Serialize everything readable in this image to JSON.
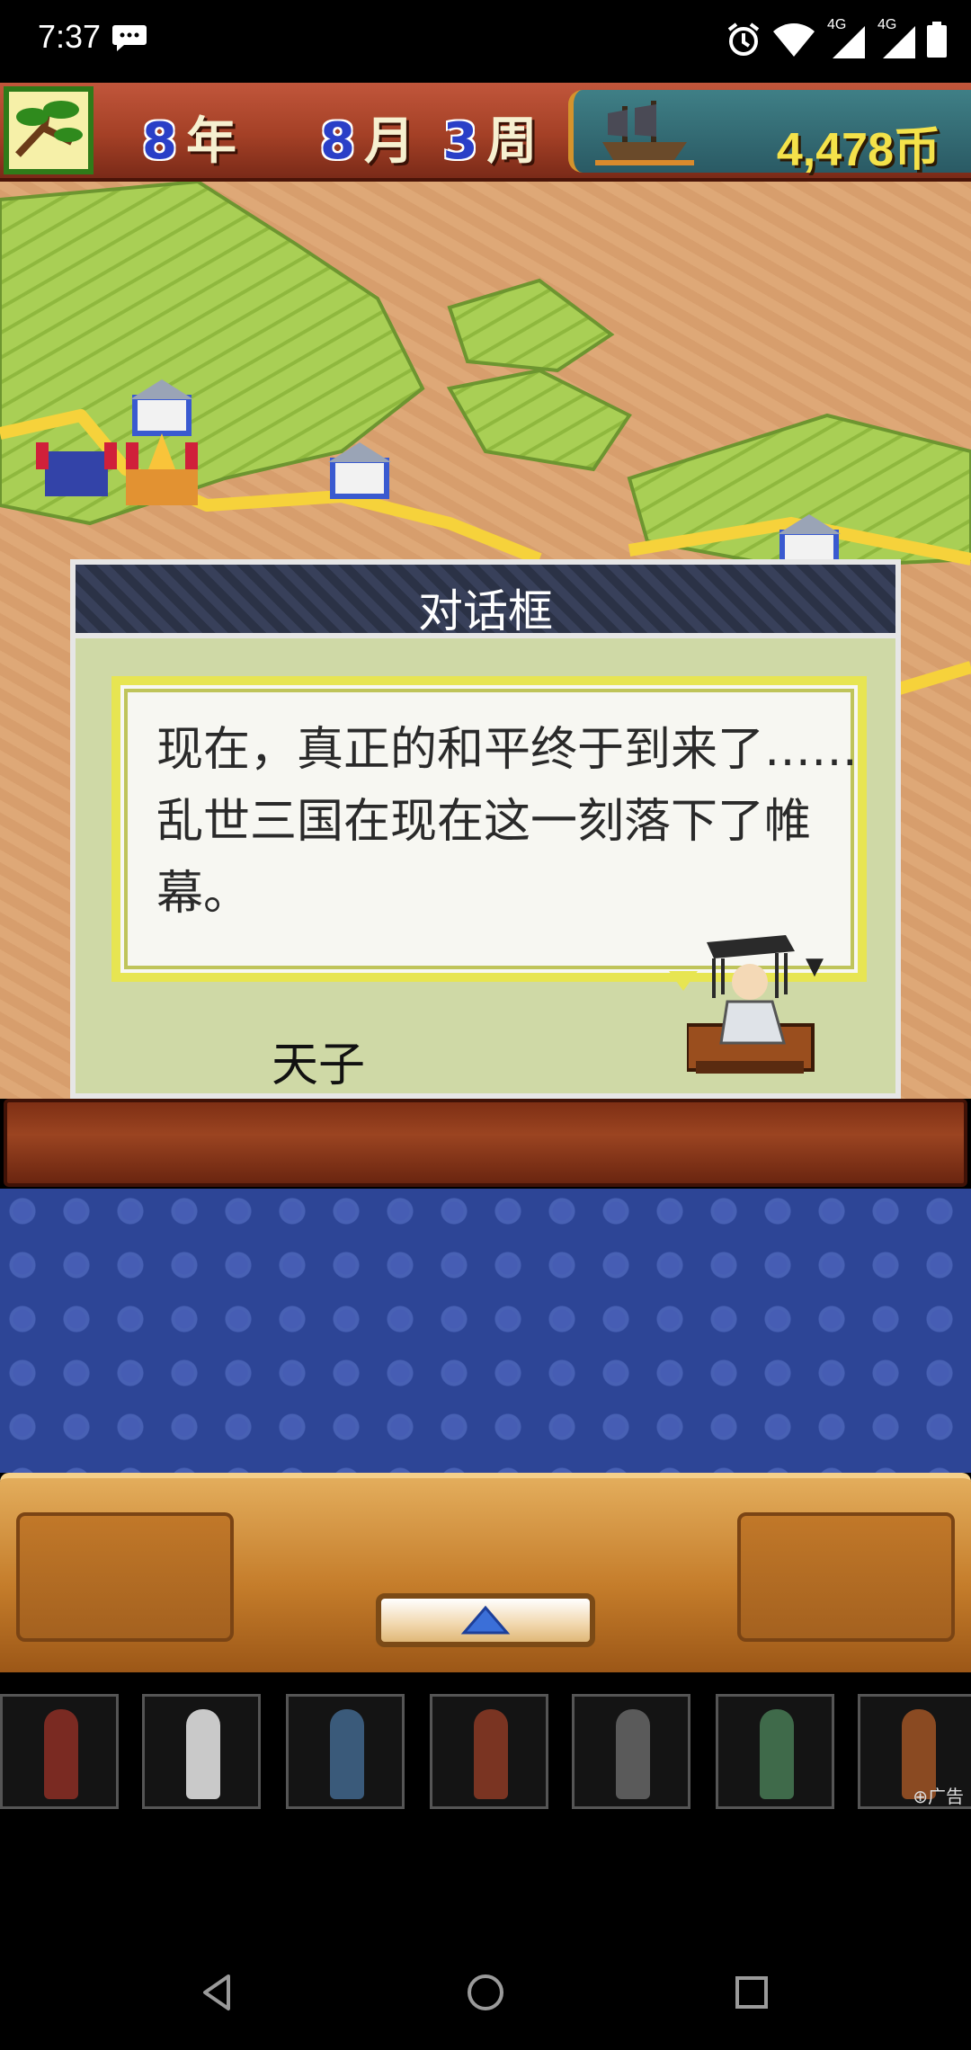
{
  "status_bar": {
    "time": "7:37",
    "network_label_1": "4G",
    "network_label_2": "4G"
  },
  "hud": {
    "year_num": "8",
    "year_unit": "年",
    "month_num": "8",
    "month_unit": "月",
    "week_num": "3",
    "week_unit": "周",
    "money": "4,478币",
    "icon": "pine-tree-icon"
  },
  "dialog": {
    "title": "对话框",
    "text": "现在，真正的和平终于到来了……乱世三国在现在这一刻落下了帷幕。",
    "speaker": "天子"
  },
  "ad": {
    "label": "广告"
  },
  "colors": {
    "hud_bar": "#a44026",
    "money_text": "#f4e24a",
    "dialog_bg": "#cfd9a6",
    "bubble_border": "#e7e552",
    "blue_panel": "#2d4596"
  }
}
